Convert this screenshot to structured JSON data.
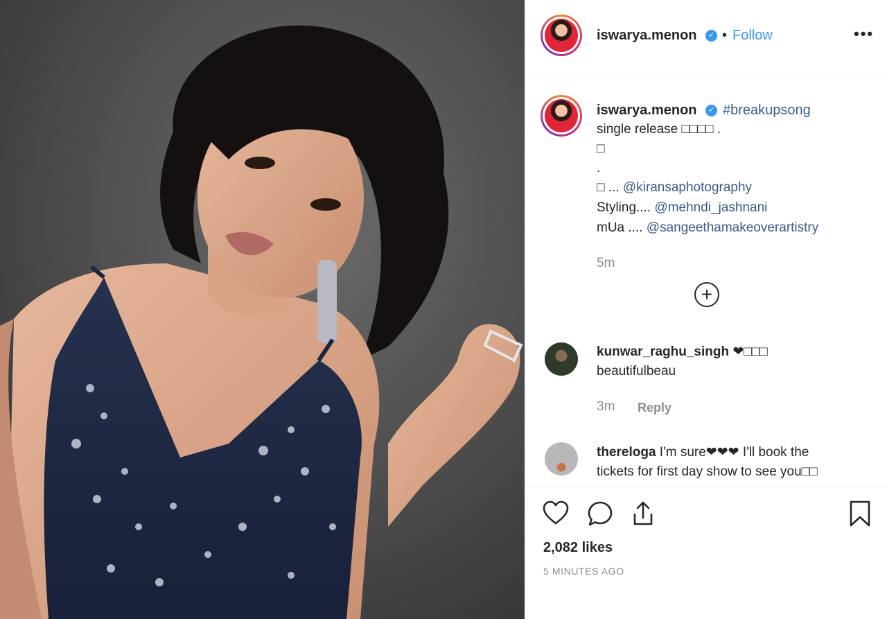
{
  "header": {
    "username": "iswarya.menon",
    "separator": "•",
    "follow_label": "Follow",
    "more_label": "•••"
  },
  "caption": {
    "username": "iswarya.menon",
    "hashtag": "#breakupsong",
    "line1": "single release □□□□ .",
    "line2": "□",
    "line3": ".",
    "line4_prefix": "□ ... ",
    "line4_mention": "@kiransaphotography",
    "line5_prefix": "Styling.... ",
    "line5_mention": "@mehndi_jashnani",
    "line6_prefix": "mUa .... ",
    "line6_mention": "@sangeethamakeoverartistry",
    "time": "5m"
  },
  "load_more": {
    "icon": "plus-circle-icon",
    "label": "+"
  },
  "comments": [
    {
      "username": "kunwar_raghu_singh",
      "inline": " ❤□□□",
      "text": "beautifulbeau",
      "time": "3m",
      "reply_label": "Reply"
    },
    {
      "username": "thereloga",
      "inline": " I'm sure❤❤❤ I'll book the",
      "text": "tickets for first day show to see you□□"
    }
  ],
  "actions": {
    "like_icon": "heart-icon",
    "comment_icon": "comment-icon",
    "share_icon": "share-icon",
    "save_icon": "bookmark-icon"
  },
  "likes": "2,082 likes",
  "posted_ago": "5 MINUTES AGO",
  "colors": {
    "link_blue": "#3897f0",
    "mention_blue": "#3b5b8a",
    "muted": "#8e8e8e",
    "text": "#262626",
    "dress_navy": "#1f2a44",
    "background_gray": "#4a4a4a"
  }
}
